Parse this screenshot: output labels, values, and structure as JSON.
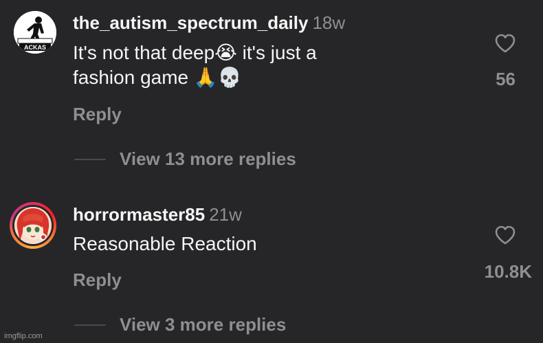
{
  "comments": [
    {
      "username": "the_autism_spectrum_daily",
      "time": "18w",
      "text_line1": "It's not that deep",
      "emoji1": "😭",
      "text_line1b": " it's just a",
      "text_line2": "fashion game ",
      "emoji2": "🙏",
      "emoji3": "💀",
      "reply_label": "Reply",
      "likes": "56",
      "view_replies": "View 13 more replies",
      "avatar_text": "ACKAS"
    },
    {
      "username": "horrormaster85",
      "time": "21w",
      "text": "Reasonable Reaction",
      "reply_label": "Reply",
      "likes": "10.8K",
      "view_replies": "View 3 more replies"
    }
  ],
  "watermark": "imgflip.com",
  "colors": {
    "background": "#262628",
    "primary_text": "#f5f5f5",
    "secondary_text": "#8e8e93"
  },
  "icons": [
    "heart-icon"
  ]
}
